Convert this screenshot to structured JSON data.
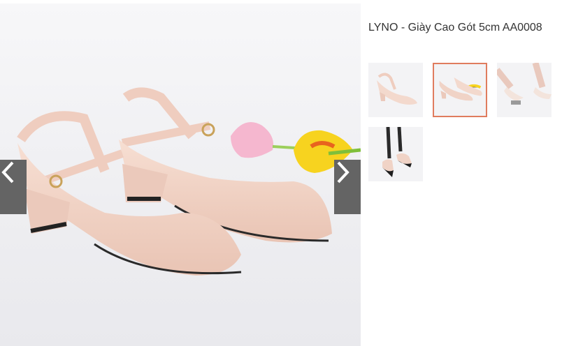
{
  "product": {
    "title": "LYNO - Giày Cao Gót 5cm AA0008"
  },
  "gallery": {
    "prev_icon": "chevron-left-icon",
    "next_icon": "chevron-right-icon",
    "active_thumbnail": 2,
    "thumbnails": [
      {
        "icon": "shoe-side-thumbnail"
      },
      {
        "icon": "shoe-pair-thumbnail"
      },
      {
        "icon": "shoe-worn-thumbnail"
      },
      {
        "icon": "shoe-black-worn-thumbnail"
      }
    ]
  },
  "colors": {
    "active_border": "#e07c5e",
    "nav_button": "#646464",
    "shoe": "#f0d3c6"
  }
}
